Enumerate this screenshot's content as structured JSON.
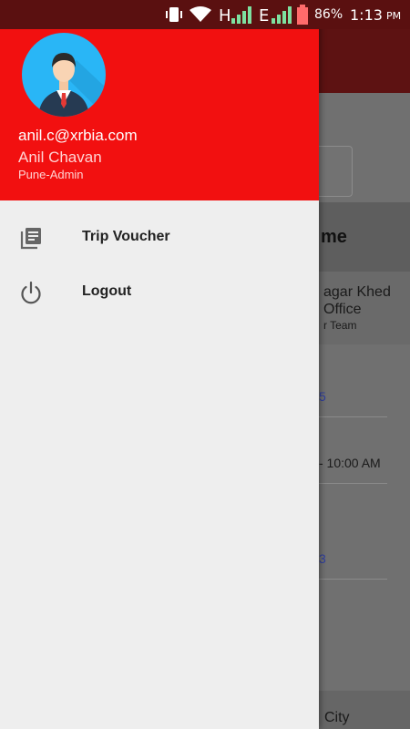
{
  "status_bar": {
    "network_h": "H",
    "network_e": "E",
    "battery_percent": "86%",
    "time": "1:13",
    "time_suffix": "PM",
    "icons": [
      "vibrate-icon",
      "wifi-icon",
      "signal-icon",
      "battery-icon"
    ]
  },
  "drawer": {
    "user": {
      "email": "anil.c@xrbia.com",
      "name": "Anil Chavan",
      "role": "Pune-Admin"
    },
    "menu": [
      {
        "label": "Trip Voucher",
        "icon": "library-books-icon"
      },
      {
        "label": "Logout",
        "icon": "power-icon"
      }
    ]
  },
  "background_app": {
    "column_title": "me",
    "row_title_line1": "agar Khed",
    "row_title_line2": "Office",
    "row_subtitle": "r Team",
    "link_fragment_1": "5",
    "time_fragment": "- 10:00 AM",
    "link_fragment_2": "3",
    "bottom_fragment": "City"
  },
  "colors": {
    "drawer_header": "#f21010",
    "status_bar": "#5a1010",
    "toolbar": "#5d1212",
    "avatar_bg": "#29b6f6"
  }
}
